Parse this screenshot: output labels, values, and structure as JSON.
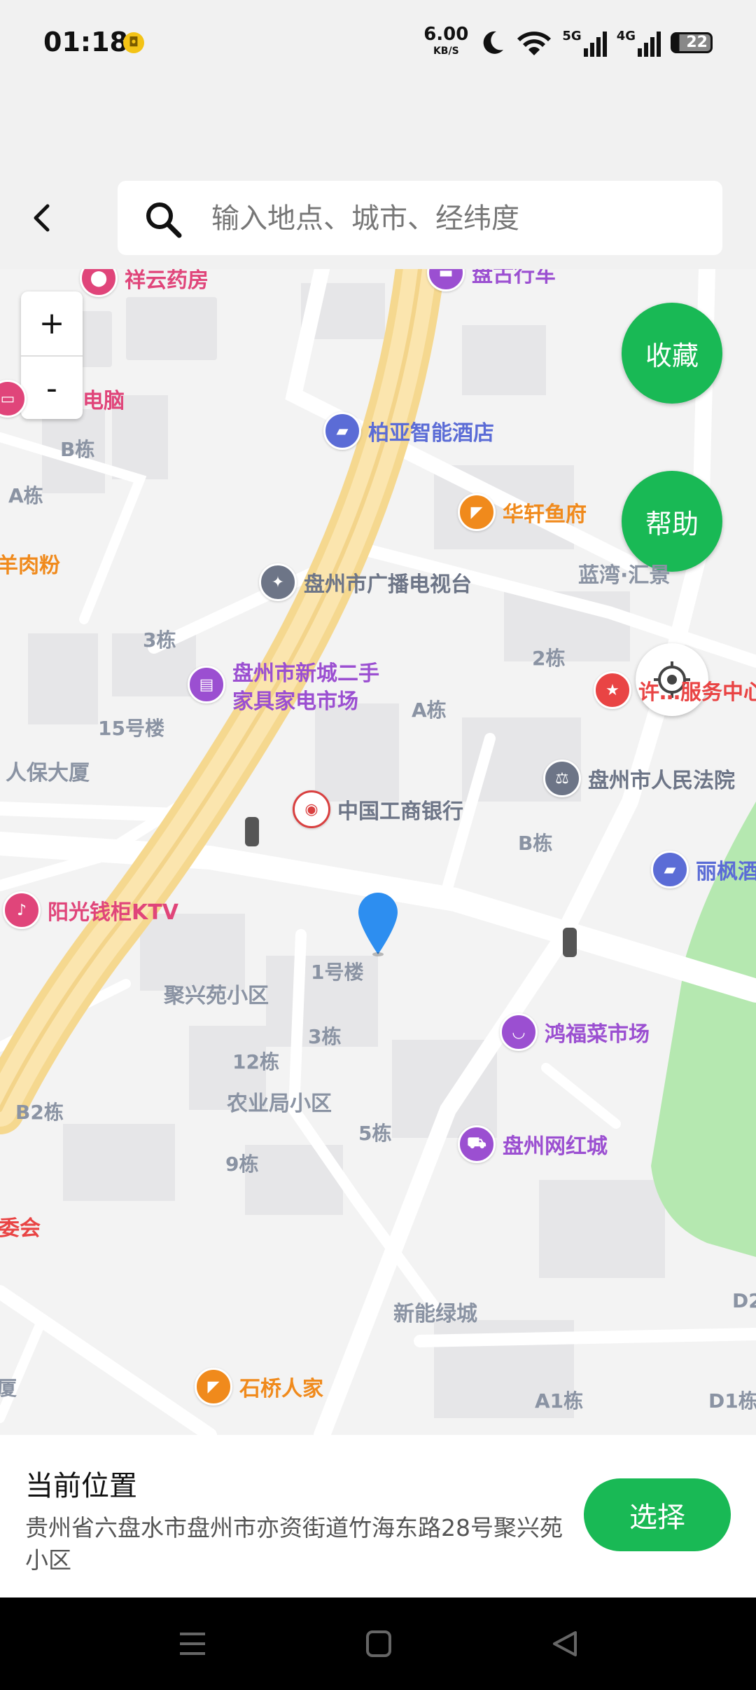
{
  "status_bar": {
    "time": "01:18",
    "speed_value": "6.00",
    "speed_unit": "KB/S",
    "network_5g": "5G",
    "network_4g": "4G",
    "battery": "22",
    "icons": [
      "notification-app-icon",
      "moon-icon",
      "wifi-icon",
      "signal-5g-icon",
      "signal-4g-icon",
      "battery-icon"
    ]
  },
  "header": {
    "search_placeholder": "输入地点、城市、经纬度"
  },
  "map": {
    "zoom_in": "+",
    "zoom_out": "-",
    "favorite_button": "收藏",
    "help_button": "帮助",
    "pois": [
      {
        "name": "祥云药房",
        "color": "#e0457a",
        "icon": "tag-icon"
      },
      {
        "name": "盘古行车",
        "color": "#9b4fd1",
        "icon": "car-icon"
      },
      {
        "name": "电脑",
        "color": "#e0457a",
        "icon": "computer-icon"
      },
      {
        "name": "柏亚智能酒店",
        "color": "#5b6cd6",
        "icon": "bed-icon"
      },
      {
        "name": "华轩鱼府",
        "color": "#f08a1c",
        "icon": "restaurant-icon"
      },
      {
        "name": "盘州市广播电视台",
        "color": "#6d7587",
        "icon": "broadcast-icon"
      },
      {
        "name": "盘州市新城二手",
        "color": "#9b4fd1",
        "icon": "shop-icon"
      },
      {
        "name": "家具家电市场",
        "color": "#9b4fd1",
        "icon": ""
      },
      {
        "name": "许…服务中心",
        "color": "#e94444",
        "icon": "star-icon"
      },
      {
        "name": "盘州市人民法院",
        "color": "#6d7587",
        "icon": "court-icon"
      },
      {
        "name": "中国工商银行",
        "color": "#d94040",
        "icon": "bank-icon"
      },
      {
        "name": "阳光钱柜KTV",
        "color": "#e0457a",
        "icon": "mic-icon"
      },
      {
        "name": "丽枫酒",
        "color": "#5b6cd6",
        "icon": "bed-icon"
      },
      {
        "name": "鸿福菜市场",
        "color": "#9b4fd1",
        "icon": "basket-icon"
      },
      {
        "name": "盘州网红城",
        "color": "#9b4fd1",
        "icon": "cart-icon"
      },
      {
        "name": "石桥人家",
        "color": "#f08a1c",
        "icon": "restaurant-icon"
      }
    ],
    "labels": [
      "B栋",
      "A栋",
      "羊肉粉",
      "3栋",
      "15号楼",
      "人保大厦",
      "2栋",
      "A栋",
      "B栋",
      "1号楼",
      "聚兴苑小区",
      "3栋",
      "12栋",
      "B2栋",
      "农业局小区",
      "5栋",
      "9栋",
      "委会",
      "新能绿城",
      "A1栋",
      "D1栋",
      "D2",
      "蓝湾·汇景",
      "厦"
    ]
  },
  "panel": {
    "title": "当前位置",
    "address": "贵州省六盘水市盘州市亦资街道竹海东路28号聚兴苑小区",
    "select_button": "选择"
  }
}
